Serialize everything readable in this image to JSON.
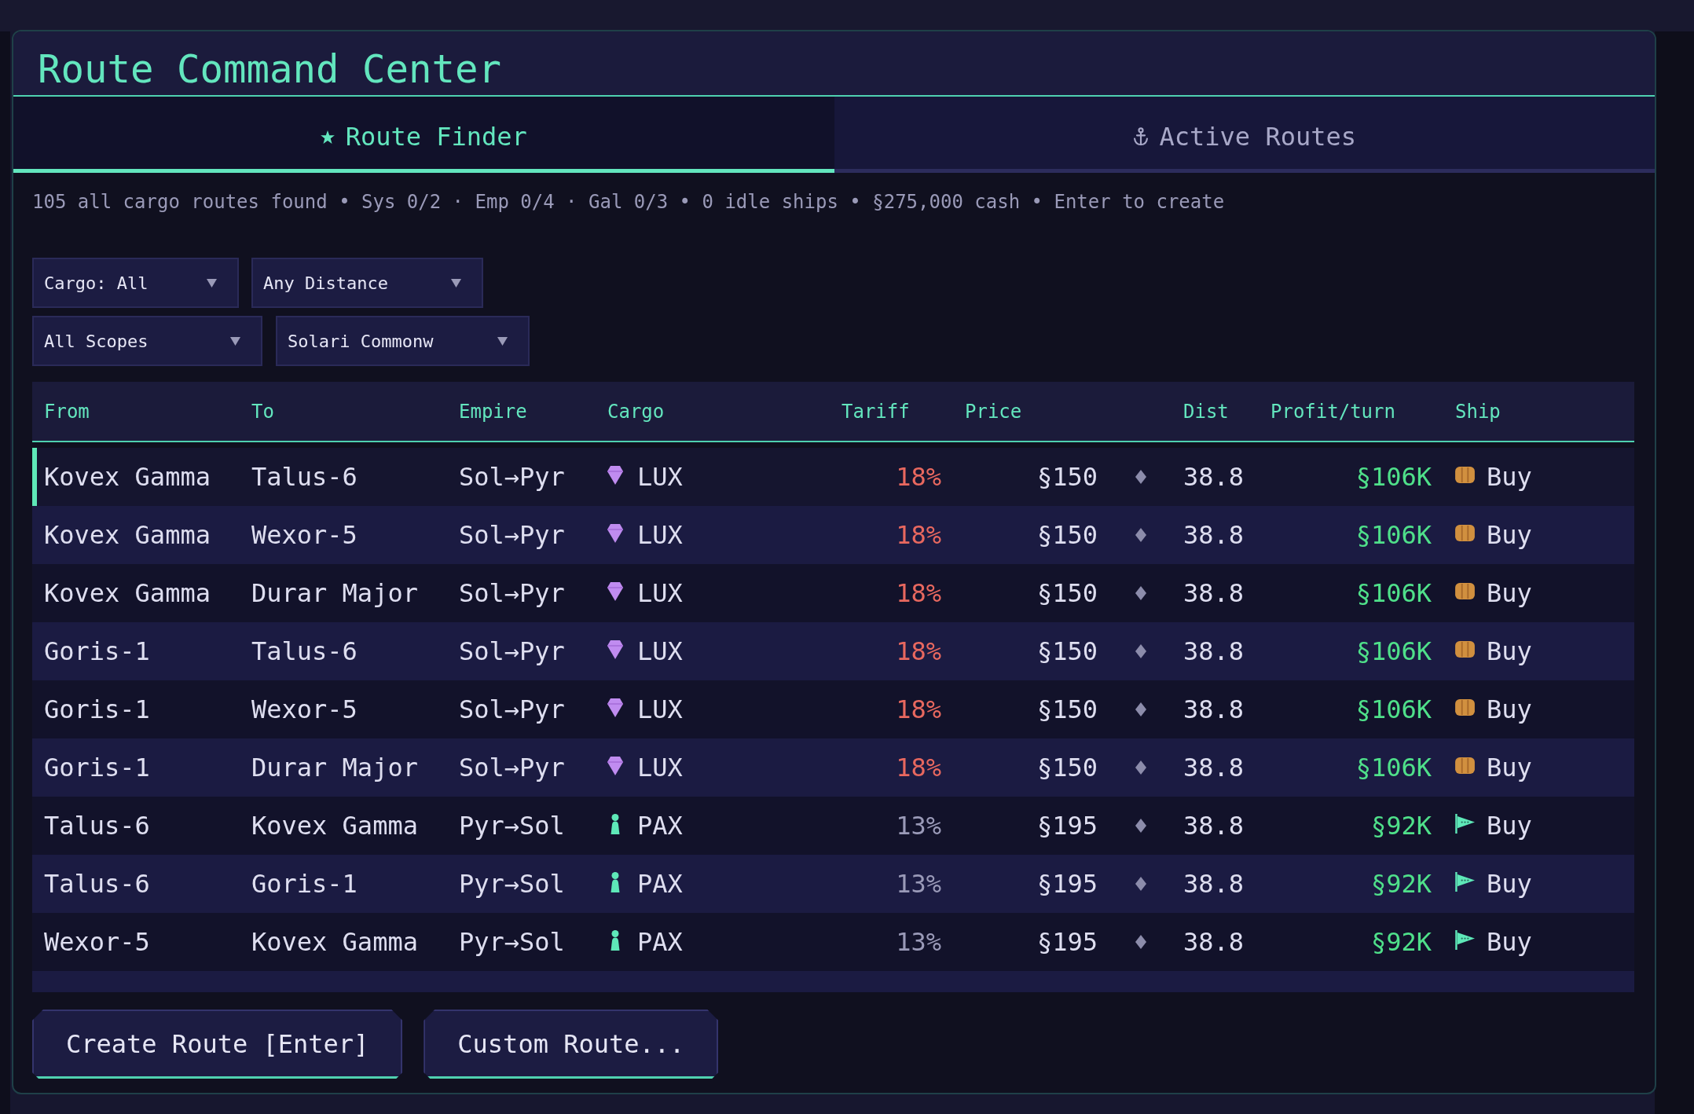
{
  "window": {
    "title": "Route Command Center"
  },
  "tabs": [
    {
      "label": "Route Finder",
      "selected": true
    },
    {
      "label": "Active Routes",
      "selected": false
    }
  ],
  "summary": "105 all cargo routes found • Sys 0/2 · Emp 0/4 · Gal 0/3 • 0 idle ships • §275,000 cash • Enter to create",
  "filter_rows": [
    {
      "dropdowns": [
        {
          "value": "Cargo: All"
        },
        {
          "value": "Any Distance"
        }
      ]
    },
    {
      "dropdowns": [
        {
          "value": "All Scopes"
        },
        {
          "value": "Solari Commonw"
        }
      ]
    }
  ],
  "table": {
    "columns": [
      "From",
      "To",
      "Empire",
      "Cargo",
      "Tariff",
      "Price",
      "Dist",
      "Profit/turn",
      "Ship"
    ],
    "rows": [
      {
        "from": "Kovex Gamma",
        "to": "Talus-6",
        "empire": "Sol→Pyr",
        "cargo": {
          "kind": "gem",
          "label": "LUX"
        },
        "tariff": "18%",
        "high_tariff": true,
        "price": "§150",
        "dist": "38.8",
        "profit": "§106K",
        "ship": {
          "kind": "barrel",
          "label": "Buy"
        },
        "selected": true
      },
      {
        "from": "Kovex Gamma",
        "to": "Wexor-5",
        "empire": "Sol→Pyr",
        "cargo": {
          "kind": "gem",
          "label": "LUX"
        },
        "tariff": "18%",
        "high_tariff": true,
        "price": "§150",
        "dist": "38.8",
        "profit": "§106K",
        "ship": {
          "kind": "barrel",
          "label": "Buy"
        },
        "selected": false
      },
      {
        "from": "Kovex Gamma",
        "to": "Durar Major",
        "empire": "Sol→Pyr",
        "cargo": {
          "kind": "gem",
          "label": "LUX"
        },
        "tariff": "18%",
        "high_tariff": true,
        "price": "§150",
        "dist": "38.8",
        "profit": "§106K",
        "ship": {
          "kind": "barrel",
          "label": "Buy"
        },
        "selected": false
      },
      {
        "from": "Goris-1",
        "to": "Talus-6",
        "empire": "Sol→Pyr",
        "cargo": {
          "kind": "gem",
          "label": "LUX"
        },
        "tariff": "18%",
        "high_tariff": true,
        "price": "§150",
        "dist": "38.8",
        "profit": "§106K",
        "ship": {
          "kind": "barrel",
          "label": "Buy"
        },
        "selected": false
      },
      {
        "from": "Goris-1",
        "to": "Wexor-5",
        "empire": "Sol→Pyr",
        "cargo": {
          "kind": "gem",
          "label": "LUX"
        },
        "tariff": "18%",
        "high_tariff": true,
        "price": "§150",
        "dist": "38.8",
        "profit": "§106K",
        "ship": {
          "kind": "barrel",
          "label": "Buy"
        },
        "selected": false
      },
      {
        "from": "Goris-1",
        "to": "Durar Major",
        "empire": "Sol→Pyr",
        "cargo": {
          "kind": "gem",
          "label": "LUX"
        },
        "tariff": "18%",
        "high_tariff": true,
        "price": "§150",
        "dist": "38.8",
        "profit": "§106K",
        "ship": {
          "kind": "barrel",
          "label": "Buy"
        },
        "selected": false
      },
      {
        "from": "Talus-6",
        "to": "Kovex Gamma",
        "empire": "Pyr→Sol",
        "cargo": {
          "kind": "person",
          "label": "PAX"
        },
        "tariff": "13%",
        "high_tariff": false,
        "price": "§195",
        "dist": "38.8",
        "profit": "§92K",
        "ship": {
          "kind": "pennant",
          "label": "Buy"
        },
        "selected": false
      },
      {
        "from": "Talus-6",
        "to": "Goris-1",
        "empire": "Pyr→Sol",
        "cargo": {
          "kind": "person",
          "label": "PAX"
        },
        "tariff": "13%",
        "high_tariff": false,
        "price": "§195",
        "dist": "38.8",
        "profit": "§92K",
        "ship": {
          "kind": "pennant",
          "label": "Buy"
        },
        "selected": false
      },
      {
        "from": "Wexor-5",
        "to": "Kovex Gamma",
        "empire": "Pyr→Sol",
        "cargo": {
          "kind": "person",
          "label": "PAX"
        },
        "tariff": "13%",
        "high_tariff": false,
        "price": "§195",
        "dist": "38.8",
        "profit": "§92K",
        "ship": {
          "kind": "pennant",
          "label": "Buy"
        },
        "selected": false
      }
    ]
  },
  "buttons": [
    "Create Route [Enter]",
    "Custom Route..."
  ]
}
